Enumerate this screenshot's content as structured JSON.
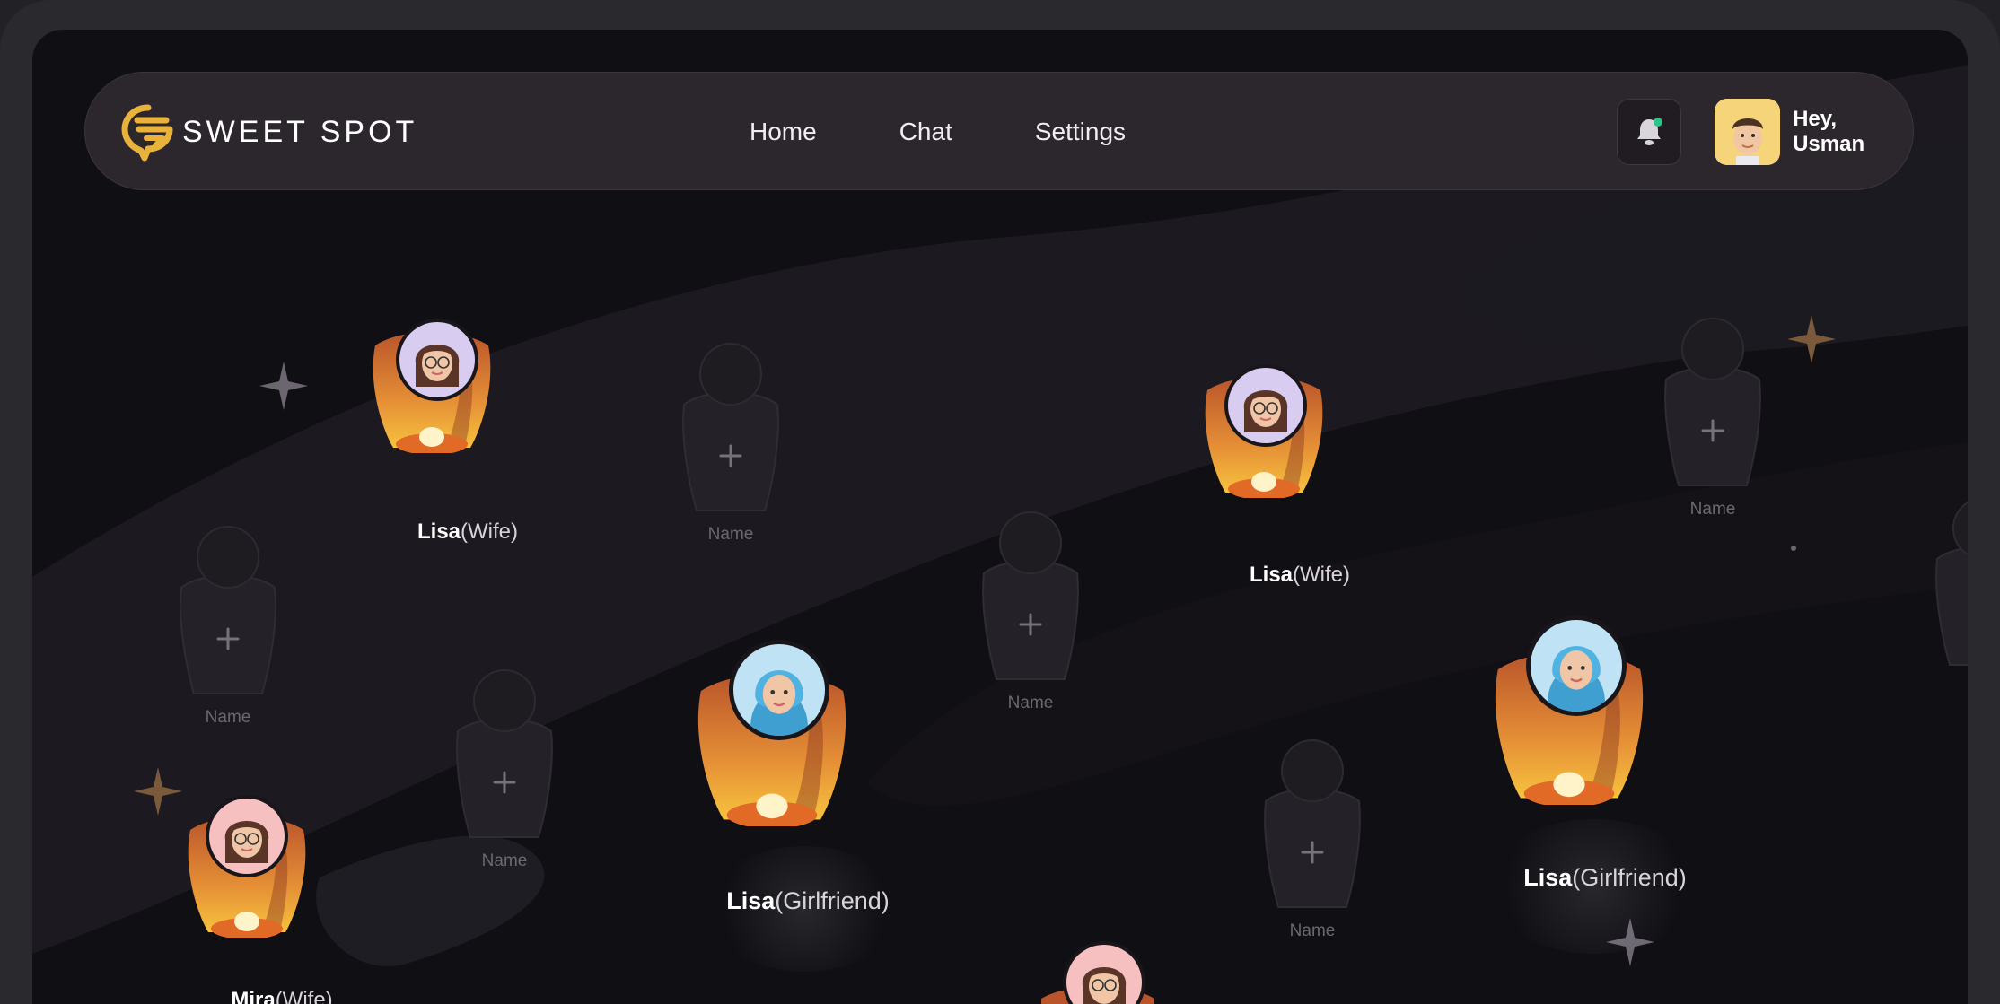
{
  "brand": {
    "name": "SWEET SPOT",
    "accent": "#e9b23a"
  },
  "nav": {
    "home": "Home",
    "chat": "Chat",
    "settings": "Settings"
  },
  "header": {
    "notification_icon": "bell-icon",
    "greeting": "Hey, Usman"
  },
  "lanterns": [
    {
      "name": "Lisa",
      "relation": "(Wife)",
      "avatar": "glasses-woman-avatar",
      "ring": "#d8cdf0"
    },
    {
      "name": "Lisa",
      "relation": "(Wife)",
      "avatar": "glasses-woman-avatar",
      "ring": "#d8cdf0"
    },
    {
      "name": "Lisa",
      "relation": "(Girlfriend)",
      "avatar": "hijab-woman-avatar",
      "ring": "#bfe3f4"
    },
    {
      "name": "Lisa",
      "relation": "(Girlfriend)",
      "avatar": "hijab-woman-avatar",
      "ring": "#bfe3f4"
    },
    {
      "name": "Mira",
      "relation": "(Wife)",
      "avatar": "glasses-woman-avatar",
      "ring": "#f6c0c0"
    }
  ],
  "empty_slots": {
    "placeholder": "Name",
    "icon": "plus-icon"
  },
  "colors": {
    "lantern_top": "#b9542b",
    "lantern_bottom": "#f7c23e",
    "background": "#100f14"
  }
}
